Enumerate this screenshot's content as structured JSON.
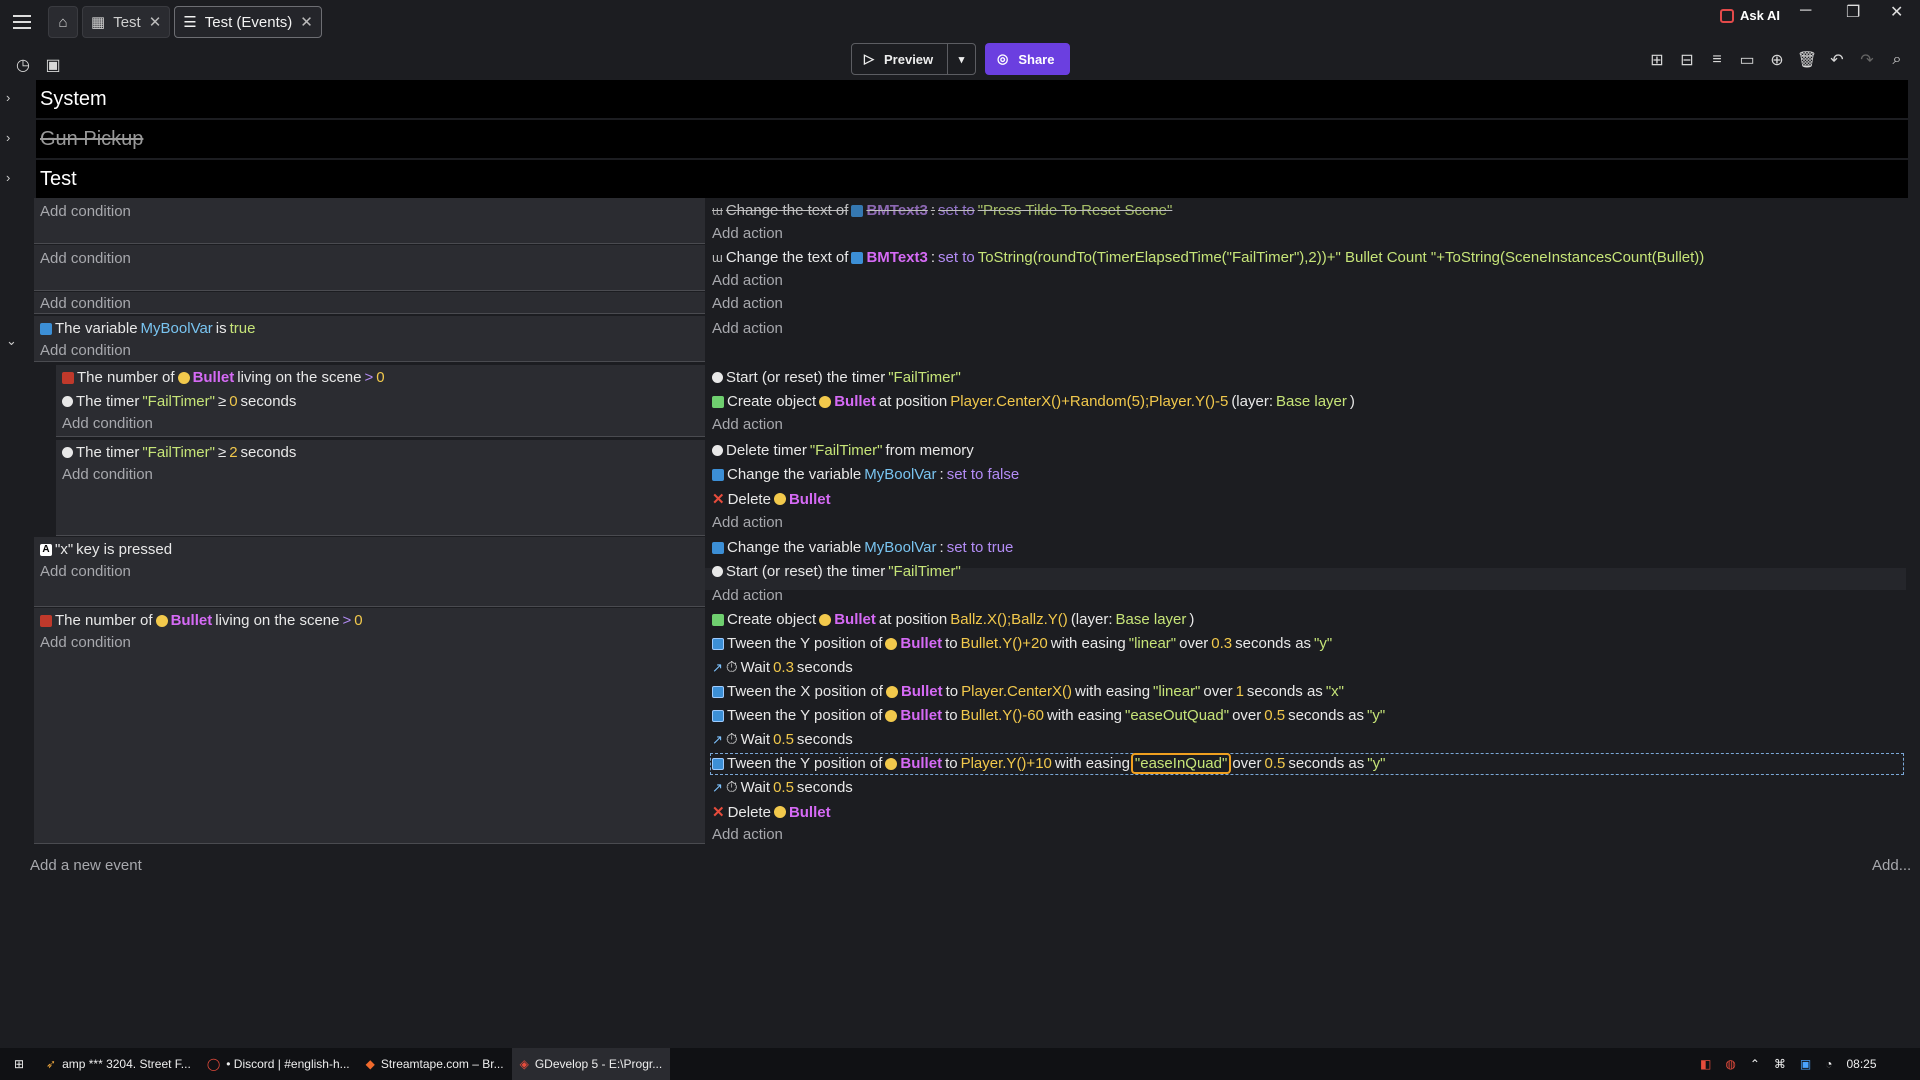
{
  "tabs": [
    {
      "label": "Test"
    },
    {
      "label": "Test (Events)"
    }
  ],
  "topbar": {
    "ask_ai": "Ask AI",
    "preview": "Preview",
    "share": "Share"
  },
  "groups": [
    "System",
    "Gun Pickup",
    "Test"
  ],
  "common": {
    "add_condition": "Add condition",
    "add_action": "Add action",
    "add_event": "Add a new event",
    "add": "Add..."
  },
  "ev1": {
    "action": "Change the text of",
    "obj": "BMText3",
    "set": "set to",
    "val": "\"Press Tilde To Reset Scene\""
  },
  "ev2": {
    "action": "Change the text of",
    "obj": "BMText3",
    "set": "set to",
    "val": "ToString(roundTo(TimerElapsedTime(\"FailTimer\"),2))+\" Bullet Count \"+ToString(SceneInstancesCount(Bullet))"
  },
  "ev4": {
    "cond_a": "The variable",
    "var": "MyBoolVar",
    "cond_b": "is",
    "cond_val": "true"
  },
  "sub1": {
    "c1a": "The number of",
    "c1obj": "Bullet",
    "c1b": "living on the scene",
    "c1op": ">",
    "c1v": "0",
    "c2a": "The timer",
    "c2t": "\"FailTimer\"",
    "c2op": "≥",
    "c2v": "0",
    "c2b": "seconds",
    "a1": "Start (or reset) the timer",
    "a1t": "\"FailTimer\"",
    "a2": "Create object",
    "a2obj": "Bullet",
    "a2b": "at position",
    "a2pos": "Player.CenterX()+Random(5);Player.Y()-5",
    "a2l": "(layer:",
    "a2lv": "Base layer",
    ")": ")"
  },
  "sub2": {
    "c1a": "The timer",
    "c1t": "\"FailTimer\"",
    "c1op": "≥",
    "c1v": "2",
    "c1b": "seconds",
    "a1": "Delete timer",
    "a1t": "\"FailTimer\"",
    "a1b": "from memory",
    "a2": "Change the variable",
    "a2v": "MyBoolVar",
    "a2s": "set to false",
    "a3": "Delete",
    "a3obj": "Bullet"
  },
  "ev5": {
    "key": "\"x\"",
    "cond": "key is pressed",
    "a1": "Change the variable",
    "a1v": "MyBoolVar",
    "a1s": "set to true",
    "a2": "Start (or reset) the timer",
    "a2t": "\"FailTimer\""
  },
  "ev6": {
    "c1a": "The number of",
    "c1obj": "Bullet",
    "c1b": "living on the scene",
    "c1op": ">",
    "c1v": "0",
    "l1": [
      "Create object",
      "Bullet",
      "at position",
      "Ballz.X();Ballz.Y()",
      "(layer:",
      "Base layer",
      ")"
    ],
    "l2": [
      "Tween the Y position of",
      "Bullet",
      "to",
      "Bullet.Y()+20",
      "with easing",
      "\"linear\"",
      "over",
      "0.3",
      "seconds as",
      "\"y\""
    ],
    "l3": [
      "Wait",
      "0.3",
      "seconds"
    ],
    "l4": [
      "Tween the X position of",
      "Bullet",
      "to",
      "Player.CenterX()",
      "with easing",
      "\"linear\"",
      "over",
      "1",
      "seconds as",
      "\"x\""
    ],
    "l5": [
      "Tween the Y position of",
      "Bullet",
      "to",
      "Bullet.Y()-60",
      "with easing",
      "\"easeOutQuad\"",
      "over",
      "0.5",
      "seconds as",
      "\"y\""
    ],
    "l6": [
      "Wait",
      "0.5",
      "seconds"
    ],
    "l7": [
      "Tween the Y position of",
      "Bullet",
      "to",
      "Player.Y()+10",
      "with easing",
      "\"easeInQuad\"",
      "over",
      "0.5",
      "seconds as",
      "\"y\""
    ],
    "l8": [
      "Wait",
      "0.5",
      "seconds"
    ],
    "l9": [
      "Delete",
      "Bullet"
    ]
  },
  "taskbar": {
    "i1": "amp *** 3204. Street F...",
    "i2": "• Discord | #english-h...",
    "i3": "Streamtape.com – Br...",
    "i4": "GDevelop 5 - E:\\Progr...",
    "time": "08:25"
  }
}
